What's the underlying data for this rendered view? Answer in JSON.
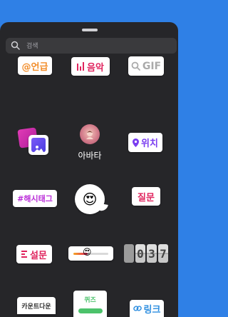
{
  "search": {
    "placeholder": "검색"
  },
  "stickers": {
    "mention": "@언급",
    "music": "음악",
    "gif": "GIF",
    "avatar": "아바타",
    "location": "위치",
    "hashtag": "#해시태그",
    "emoji_slider": "😍",
    "question": "질문",
    "poll": "설문",
    "slider_emoji": "😍",
    "countdown_digits": [
      "0",
      "3",
      "7"
    ],
    "countdown": "카운트다운",
    "quiz": "퀴즈",
    "link": "링크"
  },
  "colors": {
    "background": "#2f80e6",
    "sheet": "#262629",
    "mention": "#f28d2a",
    "music": "#e0245e",
    "location": "#7a3df0",
    "hashtag": "#bb2fd9",
    "quiz": "#4cc26b",
    "link": "#2f8fe0"
  }
}
